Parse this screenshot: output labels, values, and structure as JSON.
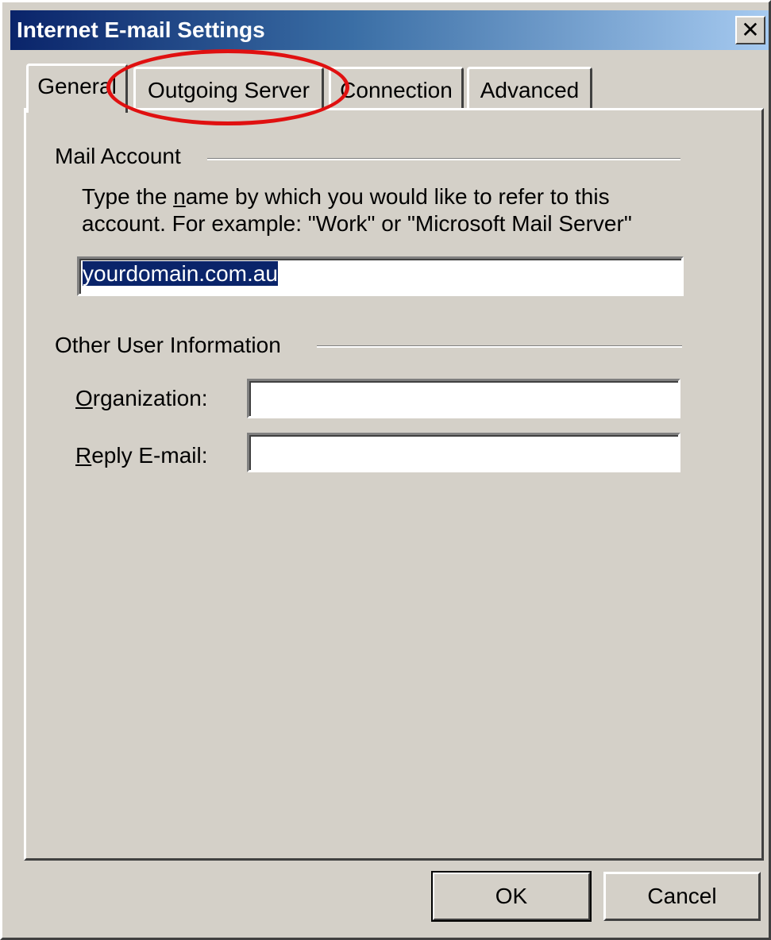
{
  "window": {
    "title": "Internet E-mail Settings",
    "close_icon": "close-icon",
    "close_symbol": "✕"
  },
  "tabs": [
    {
      "label": "General",
      "active": true
    },
    {
      "label": "Outgoing Server",
      "active": false
    },
    {
      "label": "Connection",
      "active": false
    },
    {
      "label": "Advanced",
      "active": false
    }
  ],
  "mail_account": {
    "heading": "Mail Account",
    "description_before": "Type the ",
    "description_mnemonic": "n",
    "description_after": "ame by which you would like to refer to this account.  For example: \"Work\" or \"Microsoft Mail Server\"",
    "account_name_value": "yourdomain.com.au"
  },
  "user_info": {
    "heading": "Other User Information",
    "organization_mnemonic": "O",
    "organization_rest": "rganization:",
    "organization_value": "",
    "reply_mnemonic": "R",
    "reply_rest": "eply E-mail:",
    "reply_value": ""
  },
  "buttons": {
    "ok": "OK",
    "cancel": "Cancel"
  },
  "colors": {
    "annotation": "#e01010",
    "title_gradient_start": "#0a246a",
    "title_gradient_end": "#a6caf0",
    "selection": "#0a246a"
  }
}
